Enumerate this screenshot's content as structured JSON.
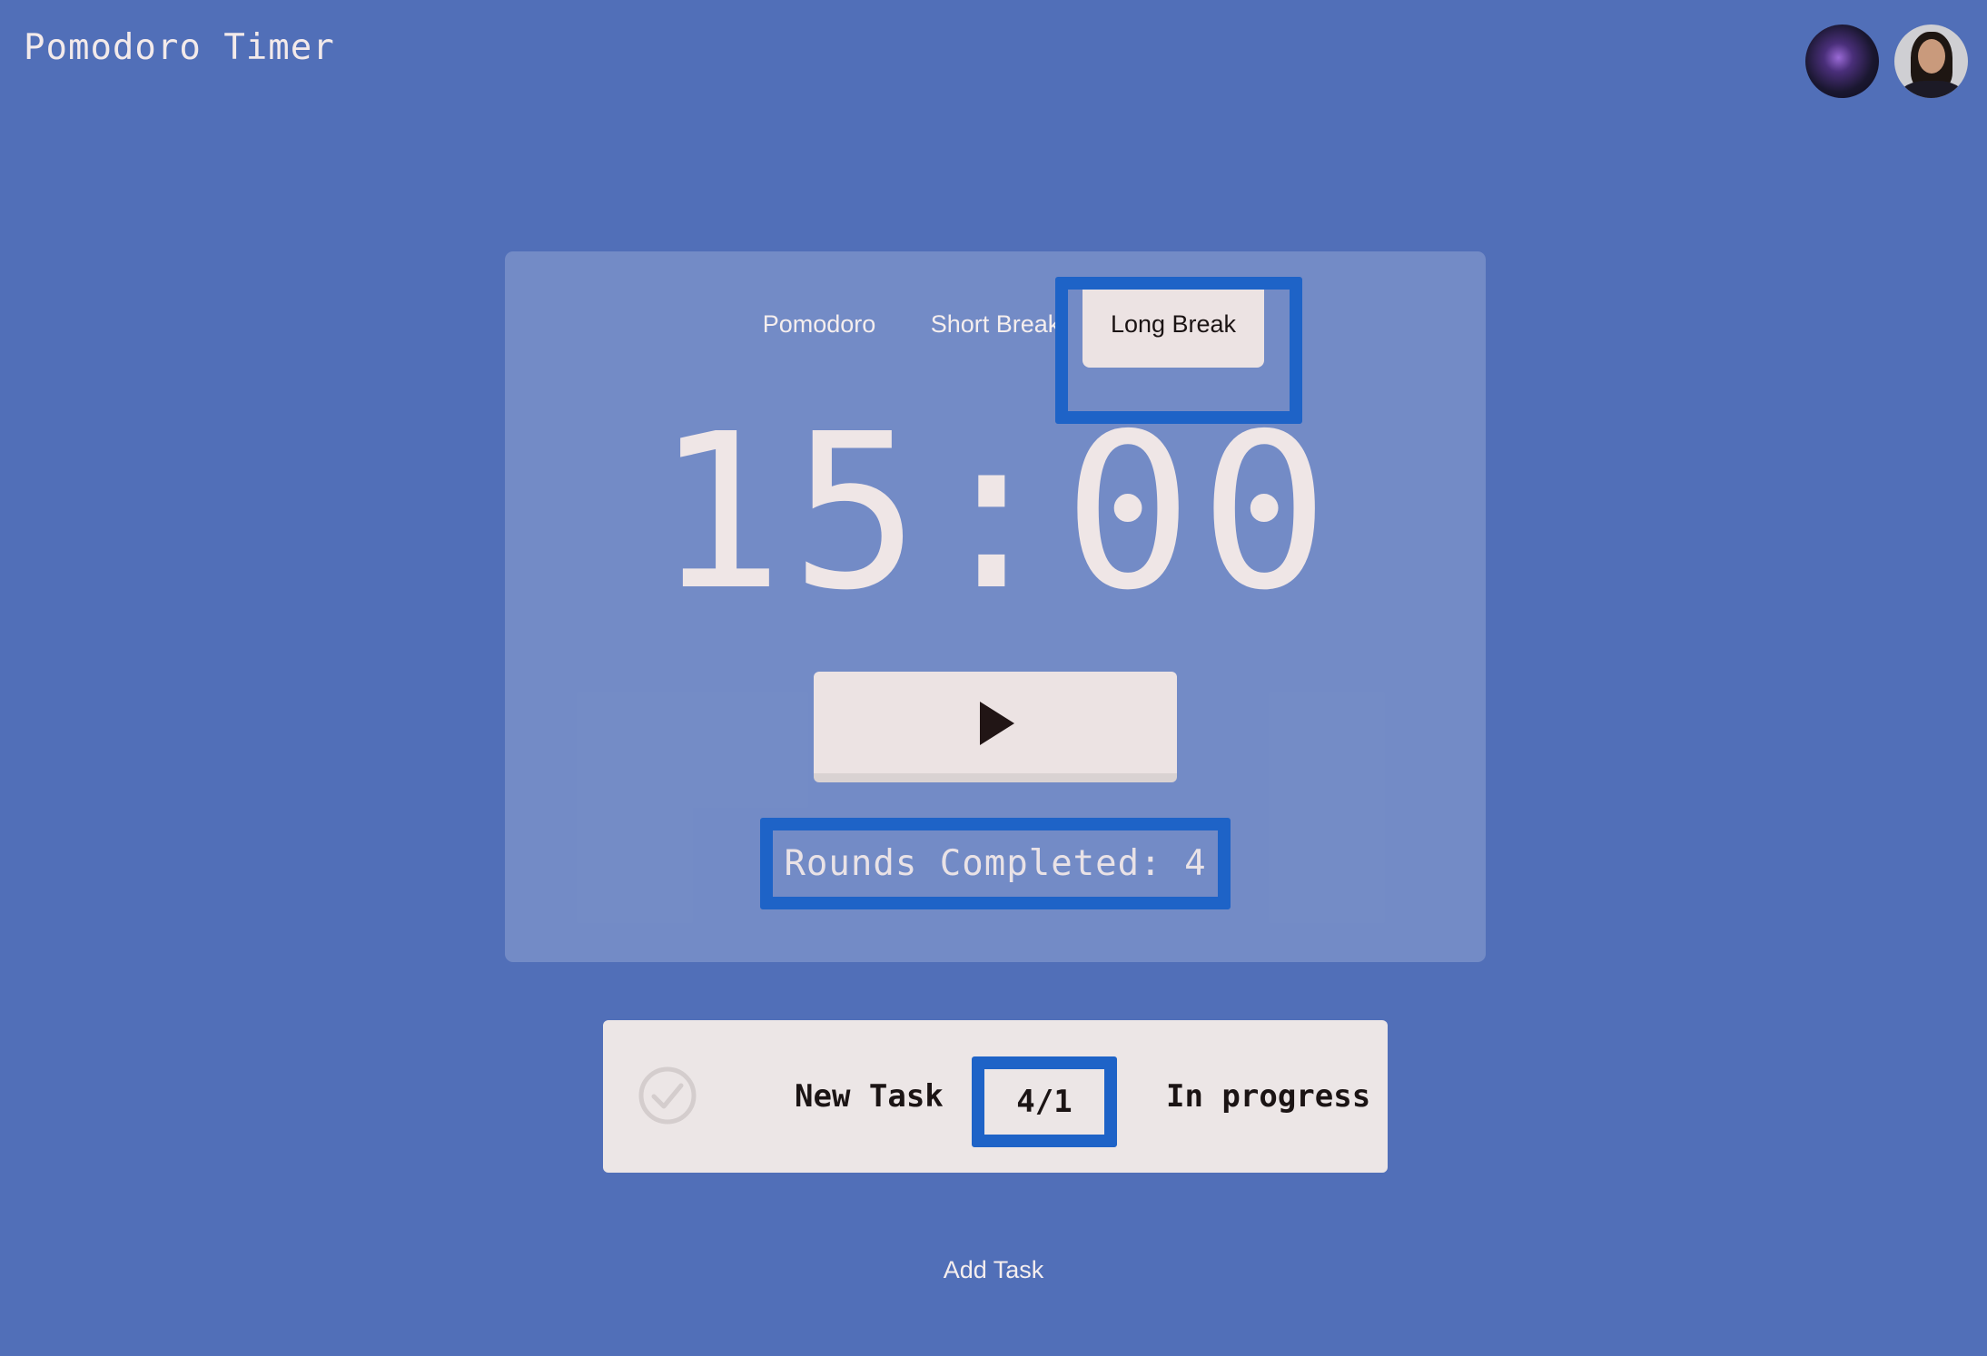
{
  "header": {
    "title": "Pomodoro Timer"
  },
  "avatars": [
    {
      "name": "avatar-abstract"
    },
    {
      "name": "avatar-user"
    }
  ],
  "timer": {
    "tabs": [
      {
        "label": "Pomodoro",
        "active": false
      },
      {
        "label": "Short Break",
        "active": false
      },
      {
        "label": "Long Break",
        "active": true
      }
    ],
    "time": "15:00",
    "start_icon": "play-icon",
    "rounds_label": "Rounds Completed: 4"
  },
  "task": {
    "icon": "check-circle-icon",
    "name": "New Task",
    "count": "4/1",
    "status": "In progress"
  },
  "add_task_label": "Add Task",
  "colors": {
    "background": "#516fb8",
    "card": "#ece3e3",
    "highlight": "#1e63c7",
    "text_dark": "#1b1414"
  }
}
